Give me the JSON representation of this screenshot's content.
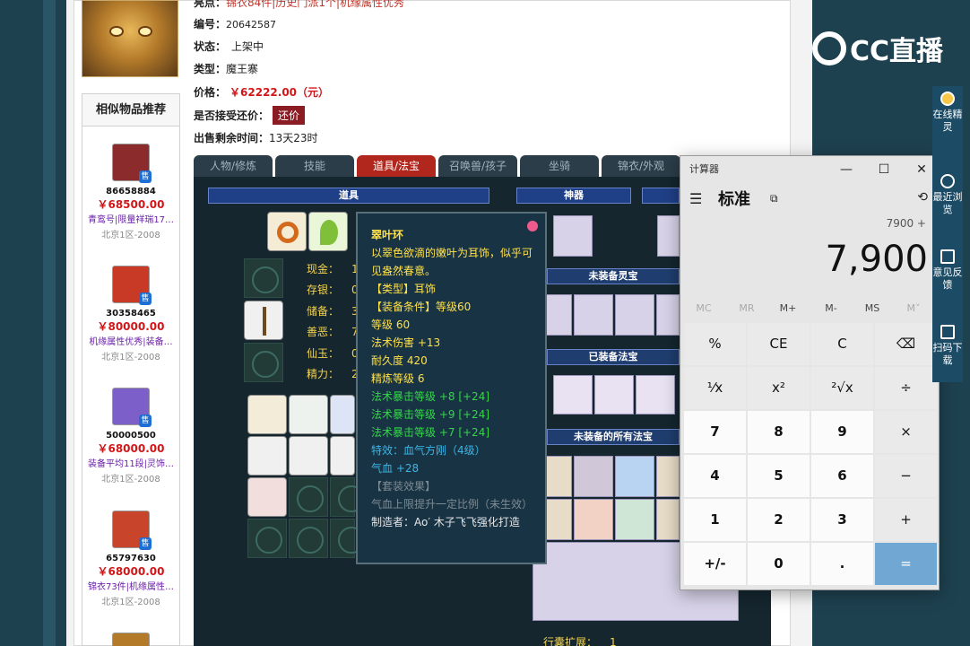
{
  "top_info": {
    "highlight_label": "亮点：",
    "highlight_text": "锦衣84件|历史门派1个|机缘属性优秀",
    "id_label": "编号：",
    "id_value": "20642587",
    "status_label": "状态：",
    "status_value": "上架中",
    "type_label": "类型：",
    "type_value": "魔王寨",
    "price_label": "价格：",
    "price_value": "￥62222.00（元）",
    "bargain_label": "是否接受还价：",
    "bargain_button": "还价",
    "time_label": "出售剩余时间：",
    "time_value": "13天23时"
  },
  "sidebar": {
    "title": "相似物品推荐",
    "items": [
      {
        "id": "86658884",
        "price": "￥68500.00",
        "desc": "青鸾号|限量祥瑞17…",
        "server": "北京1区-2008",
        "sell": "售",
        "color": "#8b2b2b"
      },
      {
        "id": "30358465",
        "price": "￥80000.00",
        "desc": "机缘属性优秀|装备…",
        "server": "北京1区-2008",
        "sell": "售",
        "color": "#c83a25"
      },
      {
        "id": "50000500",
        "price": "￥68000.00",
        "desc": "装备平均11段|灵饰…",
        "server": "北京1区-2008",
        "sell": "售",
        "color": "#7d5fc9"
      },
      {
        "id": "65797630",
        "price": "￥68000.00",
        "desc": "锦衣73件|机缘属性…",
        "server": "北京1区-2008",
        "sell": "售",
        "color": "#c8442a"
      }
    ]
  },
  "tabs": [
    {
      "label": "人物/修炼",
      "active": false
    },
    {
      "label": "技能",
      "active": false
    },
    {
      "label": "道具/法宝",
      "active": true
    },
    {
      "label": "召唤兽/孩子",
      "active": false
    },
    {
      "label": "坐骑",
      "active": false
    },
    {
      "label": "锦衣/外观",
      "active": false
    }
  ],
  "game": {
    "items_header": "道具",
    "shenqi_header": "神器",
    "unequipped_lingbao": "未装备灵宝",
    "equipped_fabao": "已装备法宝",
    "unequipped_all_fabao": "未装备的所有法宝",
    "bag_expand_label": "行囊扩展：",
    "bag_expand_value": "1",
    "stats": [
      {
        "label": "现金：",
        "value": "1"
      },
      {
        "label": "存银：",
        "value": "0"
      },
      {
        "label": "储备：",
        "value": "3"
      },
      {
        "label": "善恶：",
        "value": "7"
      },
      {
        "label": "仙玉：",
        "value": "0"
      },
      {
        "label": "精力：",
        "value": "2"
      }
    ]
  },
  "tooltip": {
    "title": "翠叶环",
    "desc": "以翠色欲滴的嫩叶为耳饰，似乎可见盎然春意。",
    "type": "【类型】耳饰",
    "req": "【装备条件】等级60",
    "level": "等级 60",
    "magic_dmg": "法术伤害 +13",
    "durability": "耐久度 420",
    "refine": "精炼等级 6",
    "crit1": "法术暴击等级 +8 [+24]",
    "crit2": "法术暴击等级 +9 [+24]",
    "crit3": "法术暴击等级 +7 [+24]",
    "special": "特效：血气方刚（4级）",
    "hp": "气血 +28",
    "set_effect": "【套装效果】",
    "set_desc": "气血上限提升一定比例（未生效）",
    "maker": "制造者：Ao′ 木子飞飞强化打造"
  },
  "calculator": {
    "window_title": "计算器",
    "mode": "标准",
    "expression": "7900 +",
    "value": "7,900",
    "memory": [
      "MC",
      "MR",
      "M+",
      "M-",
      "MS",
      "M˅"
    ],
    "keys": [
      "%",
      "CE",
      "C",
      "⌫",
      "¹⁄x",
      "x²",
      "²√x",
      "÷",
      "7",
      "8",
      "9",
      "×",
      "4",
      "5",
      "6",
      "−",
      "1",
      "2",
      "3",
      "+",
      "+/-",
      "0",
      ".",
      "="
    ]
  },
  "overlay": {
    "logo_text": "CC直播",
    "right_items": [
      "在线精灵",
      "最近浏览",
      "意见反馈",
      "扫码下载"
    ]
  }
}
